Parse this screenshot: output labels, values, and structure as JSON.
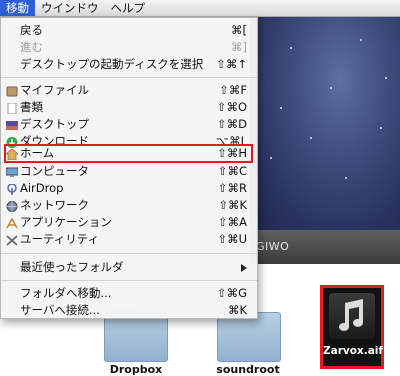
{
  "menubar": {
    "items": [
      "移動",
      "ウインドウ",
      "ヘルプ"
    ],
    "active": "移動"
  },
  "menu": {
    "items": [
      {
        "label": "戻る",
        "shortcut": "⌘[",
        "enabled": true
      },
      {
        "label": "進む",
        "shortcut": "⌘]",
        "enabled": false
      },
      {
        "label": "デスクトップの起動ディスクを選択",
        "shortcut": "⇧⌘↑",
        "enabled": true
      },
      {
        "label": "マイファイル",
        "shortcut": "⇧⌘F",
        "icon": "all-my-files-icon"
      },
      {
        "label": "書類",
        "shortcut": "⇧⌘O",
        "icon": "documents-icon"
      },
      {
        "label": "デスクトップ",
        "shortcut": "⇧⌘D",
        "icon": "desktop-icon"
      },
      {
        "label": "ダウンロード",
        "shortcut": "⌥⌘L",
        "icon": "download-icon"
      },
      {
        "label": "ホーム",
        "shortcut": "⇧⌘H",
        "icon": "home-icon"
      },
      {
        "label": "コンピュータ",
        "shortcut": "⇧⌘C",
        "icon": "computer-icon"
      },
      {
        "label": "AirDrop",
        "shortcut": "⇧⌘R",
        "icon": "airdrop-icon"
      },
      {
        "label": "ネットワーク",
        "shortcut": "⇧⌘K",
        "icon": "network-icon"
      },
      {
        "label": "アプリケーション",
        "shortcut": "⇧⌘A",
        "icon": "applications-icon"
      },
      {
        "label": "ユーティリティ",
        "shortcut": "⇧⌘U",
        "icon": "utilities-icon"
      },
      {
        "label": "最近使ったフォルダ",
        "submenu": true
      },
      {
        "label": "フォルダへ移動...",
        "shortcut": "⇧⌘G"
      },
      {
        "label": "サーバへ接続...",
        "shortcut": "⌘K"
      }
    ]
  },
  "finder": {
    "path_label": "GIWO",
    "files": [
      {
        "name": "Dropbox"
      },
      {
        "name": "soundroot"
      },
      {
        "name": "Zarvox.aif"
      }
    ]
  },
  "colors": {
    "menubar_active": "#2f5fd6",
    "highlight_border": "#e21d1d"
  }
}
